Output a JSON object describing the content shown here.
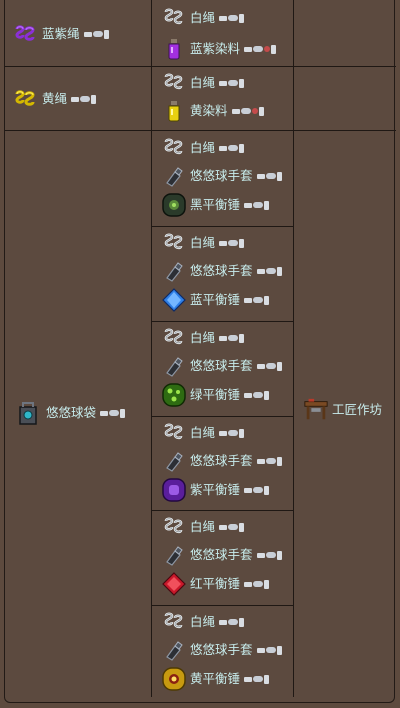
{
  "rows": [
    {
      "result": {
        "name": "蓝紫绳",
        "icon": "blue-purple-rope-icon",
        "platforms": [
          "pc",
          "console",
          "mobile"
        ]
      },
      "groups": [
        [
          {
            "name": "白绳",
            "icon": "white-rope-icon",
            "platforms": [
              "pc",
              "console",
              "mobile"
            ]
          },
          {
            "name": "蓝紫染料",
            "icon": "blue-purple-dye-icon",
            "platforms": [
              "pc",
              "console",
              "old-gen",
              "mobile"
            ]
          }
        ]
      ]
    },
    {
      "result": {
        "name": "黄绳",
        "icon": "yellow-rope-icon",
        "platforms": [
          "pc",
          "console",
          "mobile"
        ]
      },
      "groups": [
        [
          {
            "name": "白绳",
            "icon": "white-rope-icon",
            "platforms": [
              "pc",
              "console",
              "mobile"
            ]
          },
          {
            "name": "黄染料",
            "icon": "yellow-dye-icon",
            "platforms": [
              "pc",
              "console",
              "old-gen",
              "mobile"
            ]
          }
        ]
      ]
    },
    {
      "result": {
        "name": "悠悠球袋",
        "icon": "yoyo-bag-icon",
        "platforms": [
          "pc",
          "console",
          "mobile"
        ]
      },
      "station": {
        "name": "工匠作坊",
        "icon": "tinkerers-workshop-icon"
      },
      "groups": [
        [
          {
            "name": "白绳",
            "icon": "white-rope-icon",
            "platforms": [
              "pc",
              "console",
              "mobile"
            ]
          },
          {
            "name": "悠悠球手套",
            "icon": "yoyo-glove-icon",
            "platforms": [
              "pc",
              "console",
              "mobile"
            ]
          },
          {
            "name": "黑平衡锤",
            "icon": "black-counterweight-icon",
            "platforms": [
              "pc",
              "console",
              "mobile"
            ]
          }
        ],
        [
          {
            "name": "白绳",
            "icon": "white-rope-icon",
            "platforms": [
              "pc",
              "console",
              "mobile"
            ]
          },
          {
            "name": "悠悠球手套",
            "icon": "yoyo-glove-icon",
            "platforms": [
              "pc",
              "console",
              "mobile"
            ]
          },
          {
            "name": "蓝平衡锤",
            "icon": "blue-counterweight-icon",
            "platforms": [
              "pc",
              "console",
              "mobile"
            ]
          }
        ],
        [
          {
            "name": "白绳",
            "icon": "white-rope-icon",
            "platforms": [
              "pc",
              "console",
              "mobile"
            ]
          },
          {
            "name": "悠悠球手套",
            "icon": "yoyo-glove-icon",
            "platforms": [
              "pc",
              "console",
              "mobile"
            ]
          },
          {
            "name": "绿平衡锤",
            "icon": "green-counterweight-icon",
            "platforms": [
              "pc",
              "console",
              "mobile"
            ]
          }
        ],
        [
          {
            "name": "白绳",
            "icon": "white-rope-icon",
            "platforms": [
              "pc",
              "console",
              "mobile"
            ]
          },
          {
            "name": "悠悠球手套",
            "icon": "yoyo-glove-icon",
            "platforms": [
              "pc",
              "console",
              "mobile"
            ]
          },
          {
            "name": "紫平衡锤",
            "icon": "purple-counterweight-icon",
            "platforms": [
              "pc",
              "console",
              "mobile"
            ]
          }
        ],
        [
          {
            "name": "白绳",
            "icon": "white-rope-icon",
            "platforms": [
              "pc",
              "console",
              "mobile"
            ]
          },
          {
            "name": "悠悠球手套",
            "icon": "yoyo-glove-icon",
            "platforms": [
              "pc",
              "console",
              "mobile"
            ]
          },
          {
            "name": "红平衡锤",
            "icon": "red-counterweight-icon",
            "platforms": [
              "pc",
              "console",
              "mobile"
            ]
          }
        ],
        [
          {
            "name": "白绳",
            "icon": "white-rope-icon",
            "platforms": [
              "pc",
              "console",
              "mobile"
            ]
          },
          {
            "name": "悠悠球手套",
            "icon": "yoyo-glove-icon",
            "platforms": [
              "pc",
              "console",
              "mobile"
            ]
          },
          {
            "name": "黄平衡锤",
            "icon": "yellow-counterweight-icon",
            "platforms": [
              "pc",
              "console",
              "mobile"
            ]
          }
        ]
      ]
    }
  ],
  "colors": {
    "text": "#c7ecec",
    "cell_bg": "#5c4a3f",
    "border": "#1f1814"
  }
}
